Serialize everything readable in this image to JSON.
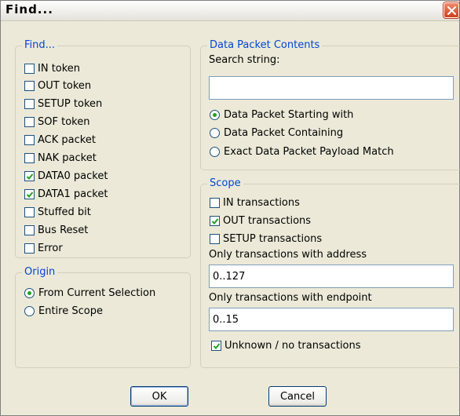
{
  "window": {
    "title": "Find..."
  },
  "find_group": {
    "legend": "Find...",
    "items": [
      {
        "label": "IN token",
        "checked": false
      },
      {
        "label": "OUT token",
        "checked": false
      },
      {
        "label": "SETUP token",
        "checked": false
      },
      {
        "label": "SOF token",
        "checked": false
      },
      {
        "label": "ACK packet",
        "checked": false
      },
      {
        "label": "NAK packet",
        "checked": false
      },
      {
        "label": "DATA0 packet",
        "checked": true
      },
      {
        "label": "DATA1 packet",
        "checked": true
      },
      {
        "label": "Stuffed bit",
        "checked": false
      },
      {
        "label": "Bus Reset",
        "checked": false
      },
      {
        "label": "Error",
        "checked": false
      }
    ]
  },
  "origin_group": {
    "legend": "Origin",
    "options": [
      {
        "label": "From Current Selection",
        "selected": true
      },
      {
        "label": "Entire Scope",
        "selected": false
      }
    ]
  },
  "packet_group": {
    "legend": "Data Packet Contents",
    "search_label": "Search string:",
    "search_value": "",
    "options": [
      {
        "label": "Data Packet Starting with",
        "selected": true
      },
      {
        "label": "Data Packet Containing",
        "selected": false
      },
      {
        "label": "Exact Data Packet Payload Match",
        "selected": false
      }
    ]
  },
  "scope_group": {
    "legend": "Scope",
    "items": [
      {
        "label": "IN transactions",
        "checked": false
      },
      {
        "label": "OUT transactions",
        "checked": true
      },
      {
        "label": "SETUP transactions",
        "checked": false
      }
    ],
    "address_label": "Only transactions with address",
    "address_value": "0..127",
    "endpoint_label": "Only transactions with endpoint",
    "endpoint_value": "0..15",
    "unknown_label": "Unknown / no transactions",
    "unknown_checked": true
  },
  "buttons": {
    "ok": "OK",
    "cancel": "Cancel"
  }
}
